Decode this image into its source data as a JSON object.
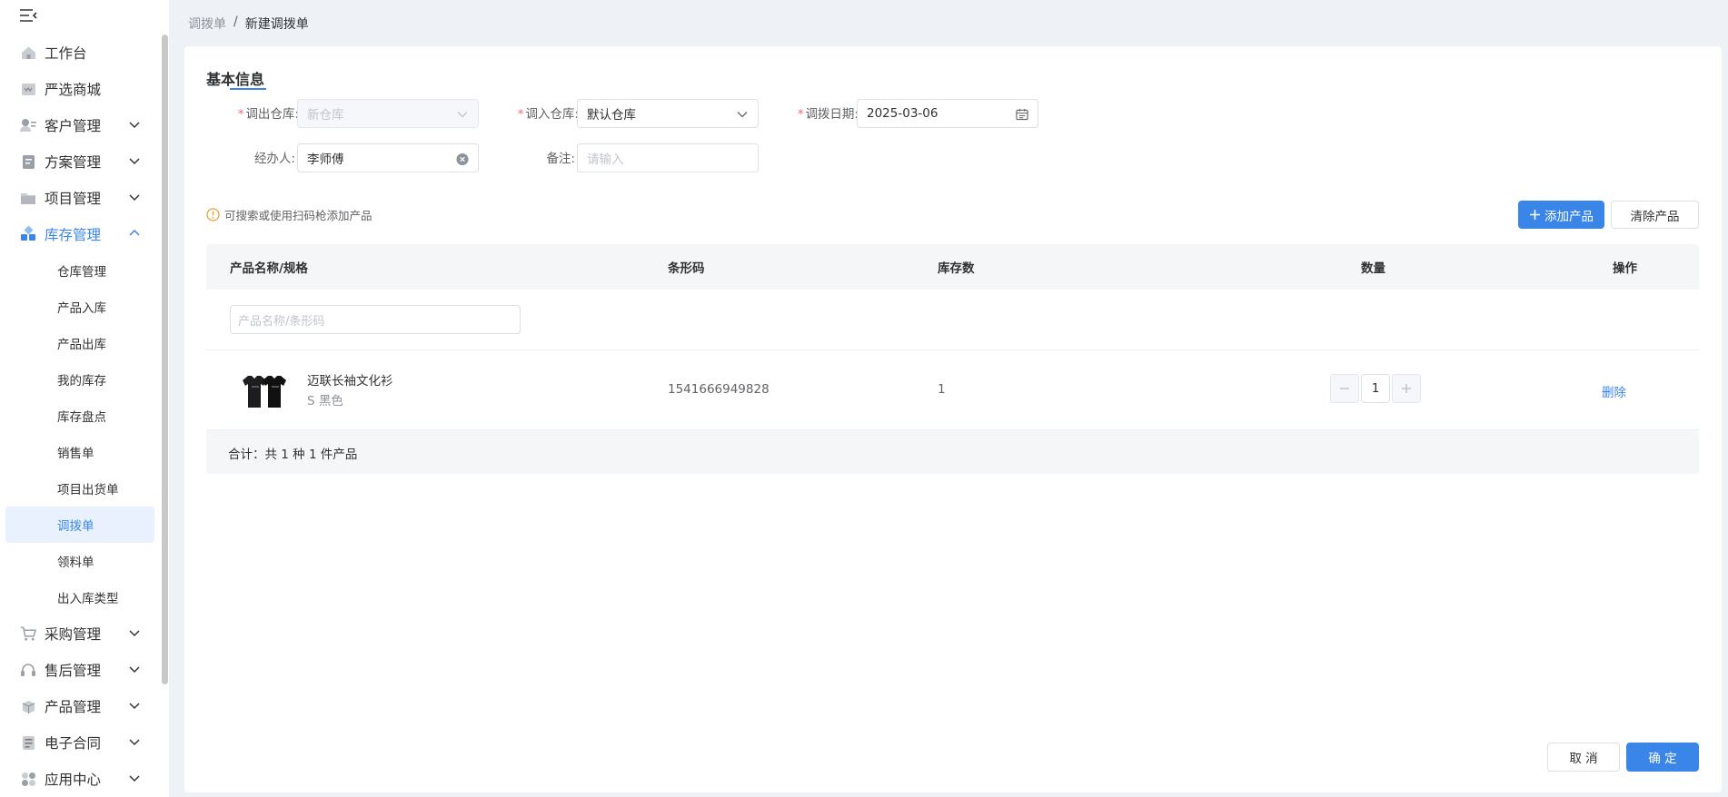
{
  "sidebar": {
    "items": [
      {
        "label": "工作台",
        "icon": "home-icon",
        "has_children": false
      },
      {
        "label": "严选商城",
        "icon": "store-icon",
        "has_children": false
      },
      {
        "label": "客户管理",
        "icon": "user-icon",
        "has_children": true
      },
      {
        "label": "方案管理",
        "icon": "document-icon",
        "has_children": true
      },
      {
        "label": "项目管理",
        "icon": "folder-icon",
        "has_children": true
      },
      {
        "label": "库存管理",
        "icon": "grid-icon",
        "has_children": true,
        "open": true
      },
      {
        "label": "采购管理",
        "icon": "cart-icon",
        "has_children": true
      },
      {
        "label": "售后管理",
        "icon": "headset-icon",
        "has_children": true
      },
      {
        "label": "产品管理",
        "icon": "box-icon",
        "has_children": true
      },
      {
        "label": "电子合同",
        "icon": "contract-icon",
        "has_children": true
      },
      {
        "label": "应用中心",
        "icon": "apps-icon",
        "has_children": true
      }
    ],
    "inventory_sub_items": [
      "仓库管理",
      "产品入库",
      "产品出库",
      "我的库存",
      "库存盘点",
      "销售单",
      "项目出货单",
      "调拨单",
      "领料单",
      "出入库类型"
    ],
    "active_sub_item": "调拨单"
  },
  "breadcrumb": {
    "parent": "调拨单",
    "separator": "/",
    "current": "新建调拨单"
  },
  "form": {
    "section_title": "基本信息",
    "out_warehouse": {
      "label": "调出仓库:",
      "placeholder": "新仓库",
      "disabled": true
    },
    "in_warehouse": {
      "label": "调入仓库:",
      "value": "默认仓库"
    },
    "date": {
      "label": "调拨日期:",
      "value": "2025-03-06"
    },
    "handler": {
      "label": "经办人:",
      "value": "李师傅"
    },
    "remark": {
      "label": "备注:",
      "placeholder": "请输入"
    }
  },
  "tip_text": "可搜索或使用扫码枪添加产品",
  "buttons": {
    "add_product": "添加产品",
    "clear_products": "清除产品",
    "cancel": "取 消",
    "confirm": "确 定"
  },
  "table": {
    "headers": {
      "product": "产品名称/规格",
      "barcode": "条形码",
      "stock": "库存数",
      "quantity": "数量",
      "actions": "操作"
    },
    "filter_placeholder": "产品名称/条形码",
    "rows": [
      {
        "name": "迈联长袖文化衫",
        "spec": "S 黑色",
        "barcode": "1541666949828",
        "stock": "1",
        "quantity": "1",
        "action": "删除"
      }
    ],
    "summary": "合计：共 1 种 1 件产品"
  },
  "colors": {
    "accent": "#3a86e8",
    "required": "#f56c6c",
    "warning": "#e6a23c"
  }
}
